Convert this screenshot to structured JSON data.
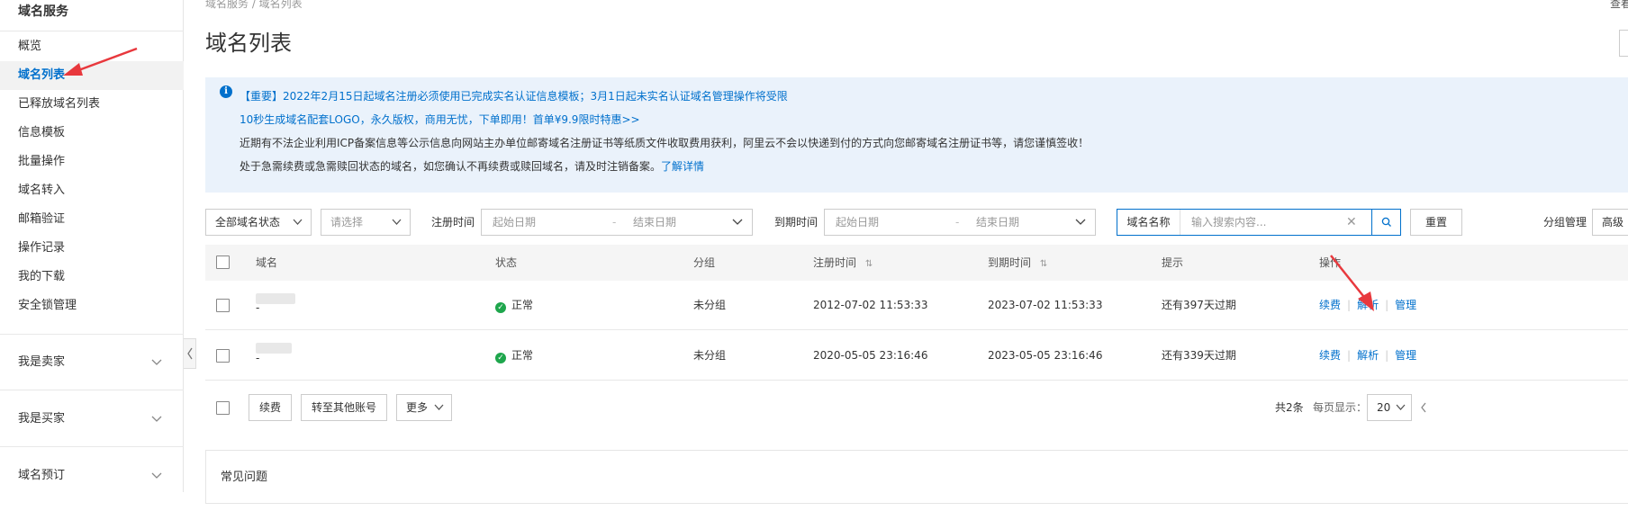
{
  "sidebar": {
    "title": "域名服务",
    "items": [
      {
        "label": "概览"
      },
      {
        "label": "域名列表"
      },
      {
        "label": "已释放域名列表"
      },
      {
        "label": "信息模板"
      },
      {
        "label": "批量操作"
      },
      {
        "label": "域名转入"
      },
      {
        "label": "邮箱验证"
      },
      {
        "label": "操作记录"
      },
      {
        "label": "我的下载"
      },
      {
        "label": "安全锁管理"
      }
    ],
    "groups": [
      {
        "label": "我是卖家"
      },
      {
        "label": "我是买家"
      },
      {
        "label": "域名预订"
      }
    ]
  },
  "header": {
    "breadcrumb": "域名服务  /  域名列表",
    "title": "域名列表",
    "topright": "查看"
  },
  "notice": {
    "line1_important": "【重要】",
    "line1_text": "2022年2月15日起域名注册必须使用已完成实名认证信息模板；3月1日起未实名认证域名管理操作将受限",
    "line2": "10秒生成域名配套LOGO，永久版权，商用无忧，下单即用！首单¥9.9限时特惠>>",
    "line3": "近期有不法企业利用ICP备案信息等公示信息向网站主办单位邮寄域名注册证书等纸质文件收取费用获利，阿里云不会以快递到付的方式向您邮寄域名注册证书等，请您谨慎签收！",
    "line4_text": "处于急需续费或急需赎回状态的域名，如您确认不再续费或赎回域名，请及时注销备案。",
    "line4_link": "了解详情"
  },
  "filters": {
    "status_select": "全部域名状态",
    "group_select": "请选择",
    "reg_label": "注册时间",
    "reg_start": "起始日期",
    "reg_end": "结束日期",
    "exp_label": "到期时间",
    "exp_start": "起始日期",
    "exp_end": "结束日期",
    "search_label": "域名名称",
    "search_placeholder": "输入搜索内容...",
    "reset": "重置",
    "group_manage": "分组管理",
    "advanced": "高级"
  },
  "table": {
    "columns": {
      "domain": "域名",
      "status": "状态",
      "group": "分组",
      "reg_time": "注册时间",
      "exp_time": "到期时间",
      "tip": "提示",
      "ops": "操作"
    },
    "rows": [
      {
        "domain_suffix": "-",
        "status": "正常",
        "group": "未分组",
        "reg_time": "2012-07-02 11:53:33",
        "exp_time": "2023-07-02 11:53:33",
        "tip": "还有397天过期",
        "op1": "续费",
        "op2": "解析",
        "op3": "管理"
      },
      {
        "domain_suffix": "-",
        "status": "正常",
        "group": "未分组",
        "reg_time": "2020-05-05 23:16:46",
        "exp_time": "2023-05-05 23:16:46",
        "tip": "还有339天过期",
        "op1": "续费",
        "op2": "解析",
        "op3": "管理"
      }
    ],
    "footer": {
      "renew": "续费",
      "transfer": "转至其他账号",
      "more": "更多",
      "total": "共2条",
      "per_page_label": "每页显示：",
      "per_page": "20"
    }
  },
  "faq": {
    "title": "常见问题"
  },
  "colors": {
    "accent": "#0070cc",
    "notice_bg": "#eaf2fb",
    "ok": "#1ea64c",
    "annotation": "#e8383d"
  }
}
